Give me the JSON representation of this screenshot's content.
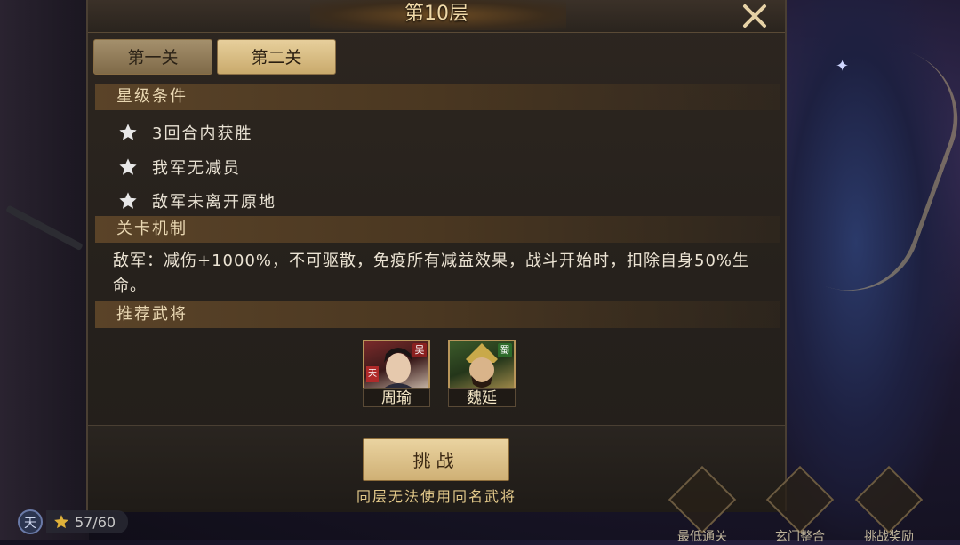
{
  "window": {
    "title": "第10层"
  },
  "tabs": [
    {
      "label": "第一关",
      "active": false
    },
    {
      "label": "第二关",
      "active": true
    }
  ],
  "star_conditions": {
    "header": "星级条件",
    "items": [
      "3回合内获胜",
      "我军无减员",
      "敌军未离开原地"
    ]
  },
  "mechanics": {
    "header": "关卡机制",
    "text": "敌军：减伤+1000%，不可驱散，免疫所有减益效果，战斗开始时，扣除自身50%生命。"
  },
  "recommended": {
    "header": "推荐武将",
    "heroes": [
      {
        "name": "周瑜",
        "faction": "吴",
        "tag": "天"
      },
      {
        "name": "魏延",
        "faction": "蜀",
        "tag": ""
      }
    ]
  },
  "footer": {
    "challenge_label": "挑战",
    "notice": "同层无法使用同名武将"
  },
  "status": {
    "badge": "天",
    "score": "57/60"
  },
  "side_buttons": [
    {
      "label": "最低通关",
      "icon": "scroll-icon"
    },
    {
      "label": "玄门整合",
      "icon": "gate-icon"
    },
    {
      "label": "挑战奖励",
      "icon": "chest-icon"
    }
  ],
  "colors": {
    "accent_gold": "#e7cf9c",
    "text_light": "#ece4d4",
    "header_text": "#e9d7b2"
  }
}
